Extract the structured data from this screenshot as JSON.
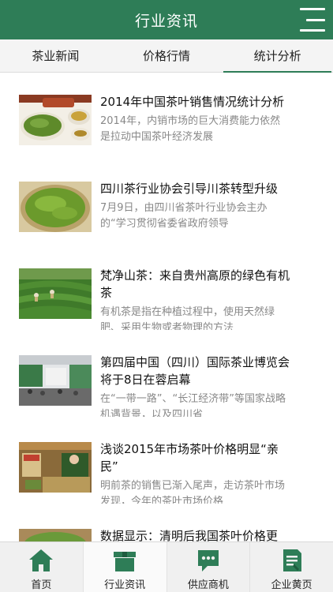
{
  "header": {
    "title": "行业资讯"
  },
  "tabs": [
    {
      "label": "茶业新闻"
    },
    {
      "label": "价格行情"
    },
    {
      "label": "统计分析"
    }
  ],
  "articles": [
    {
      "title": "2014年中国茶叶销售情况统计分析",
      "desc": "2014年，内销市场的巨大消费能力依然是拉动中国茶叶经济发展",
      "image": "tea-cups"
    },
    {
      "title": "四川茶行业协会引导川茶转型升级",
      "desc": "7月9日，由四川省茶叶行业协会主办的“学习贯彻省委省政府领导",
      "image": "green-tea-basket"
    },
    {
      "title": "梵净山茶：来自贵州高原的绿色有机茶",
      "desc": "有机茶是指在种植过程中，使用天然绿肥、采用生物或者物理的方法",
      "image": "tea-field"
    },
    {
      "title": "第四届中国（四川）国际茶业博览会将于8日在蓉启幕",
      "desc": "在“一带一路”、“长江经济带”等国家战略机遇背景，以及四川省",
      "image": "expo-hall"
    },
    {
      "title": "浅谈2015年市场茶叶价格明显“亲民”",
      "desc": "明前茶的销售已渐入尾声，走访茶叶市场发现，今年的茶叶市场价格",
      "image": "tea-market"
    },
    {
      "title": "数据显示：清明后我国茶叶价格更",
      "desc": "",
      "image": "tea-plate"
    }
  ],
  "bottom_nav": [
    {
      "label": "首页",
      "icon": "home-icon"
    },
    {
      "label": "行业资讯",
      "icon": "box-icon"
    },
    {
      "label": "供应商机",
      "icon": "chat-icon"
    },
    {
      "label": "企业黄页",
      "icon": "document-icon"
    }
  ],
  "colors": {
    "primary": "#2e7d57",
    "desc_text": "#888888"
  }
}
